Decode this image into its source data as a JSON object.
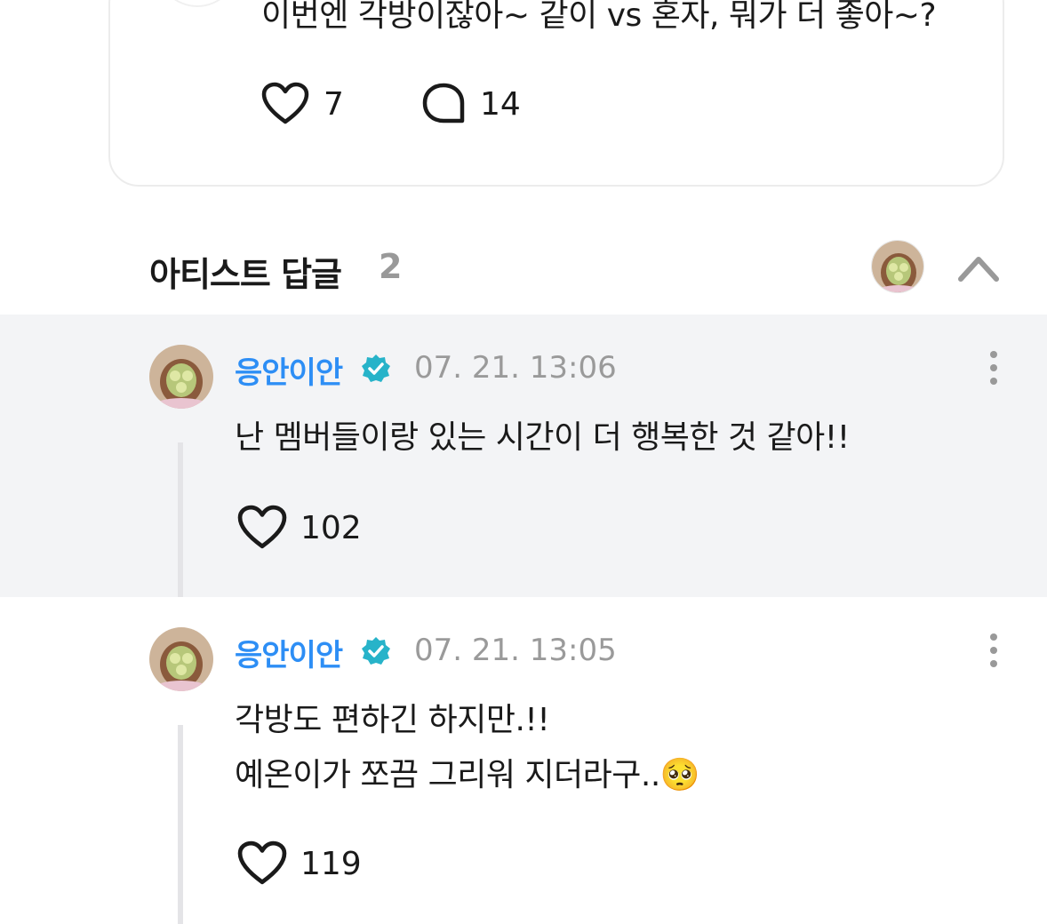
{
  "post": {
    "text": "이번엔 각방이잖아~ 같이 vs 혼자, 뭐가 더 좋아~?",
    "likes": "7",
    "comments": "14"
  },
  "artist_replies": {
    "title": "아티스트 답글",
    "count": "2",
    "items": [
      {
        "author": "응안이안",
        "time": "07. 21. 13:06",
        "lines": [
          "난 멤버들이랑 있는 시간이 더 행복한 것 같아!!"
        ],
        "likes": "102"
      },
      {
        "author": "응안이안",
        "time": "07. 21. 13:05",
        "lines": [
          "각방도 편하긴 하지만.!!",
          "예온이가 쪼끔 그리워 지더라구..🥺"
        ],
        "likes": "119"
      }
    ]
  },
  "colors": {
    "author": "#2d8ef5",
    "verified": "#27b3c9",
    "reply_bg": "#f3f4f6",
    "muted": "#9a9a9a"
  },
  "icons": {
    "like": "heart-icon",
    "comment": "comment-bubble-icon",
    "verified": "verified-badge-icon",
    "more": "more-vertical-icon",
    "collapse": "chevron-up-icon"
  }
}
